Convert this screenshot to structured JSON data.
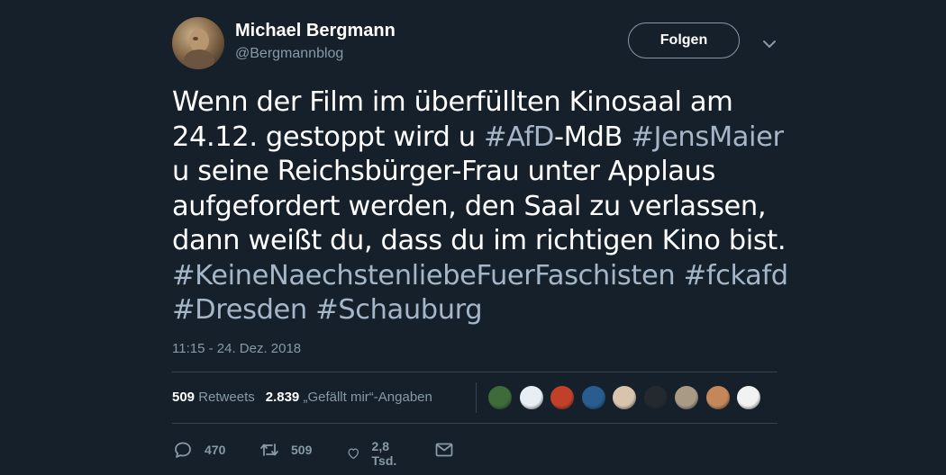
{
  "author": {
    "display_name": "Michael Bergmann",
    "handle": "@Bergmannblog"
  },
  "header": {
    "follow_label": "Folgen"
  },
  "tweet": {
    "lines": [
      [
        {
          "t": "Wenn der Film im überfüllten Kinosaal am",
          "h": false
        }
      ],
      [
        {
          "t": "24.12. gestoppt wird u ",
          "h": false
        },
        {
          "t": "#AfD",
          "h": true
        },
        {
          "t": "-MdB ",
          "h": false
        },
        {
          "t": "#JensMaier",
          "h": true
        }
      ],
      [
        {
          "t": "u seine Reichsbürger-Frau unter Applaus",
          "h": false
        }
      ],
      [
        {
          "t": "aufgefordert werden, den Saal zu verlassen,",
          "h": false
        }
      ],
      [
        {
          "t": "dann weißt du, dass du im richtigen Kino bist.",
          "h": false
        }
      ],
      [
        {
          "t": "#KeineNaechstenliebeFuerFaschisten",
          "h": true
        },
        {
          "t": " ",
          "h": false
        },
        {
          "t": "#fckafd",
          "h": true
        }
      ],
      [
        {
          "t": "#Dresden",
          "h": true
        },
        {
          "t": " ",
          "h": false
        },
        {
          "t": "#Schauburg",
          "h": true
        }
      ]
    ],
    "timestamp": "11:15 - 24. Dez. 2018"
  },
  "stats": {
    "retweets_count": "509",
    "retweets_label": "Retweets",
    "likes_count": "2.839",
    "likes_label": "„Gefällt mir“-Angaben"
  },
  "liked_by_avatars": [
    {
      "name": "liker-avatar-1",
      "color": "#3f6b3a"
    },
    {
      "name": "liker-avatar-2",
      "color": "#e8eef4"
    },
    {
      "name": "liker-avatar-3",
      "color": "#c2402a"
    },
    {
      "name": "liker-avatar-4",
      "color": "#2a5d8f"
    },
    {
      "name": "liker-avatar-5",
      "color": "#d8c3ad"
    },
    {
      "name": "liker-avatar-6",
      "color": "#23292f"
    },
    {
      "name": "liker-avatar-7",
      "color": "#a99a86"
    },
    {
      "name": "liker-avatar-8",
      "color": "#c4875a"
    },
    {
      "name": "liker-avatar-9",
      "color": "#f2f2f2"
    }
  ],
  "actions": {
    "reply_count": "470",
    "retweet_count": "509",
    "like_count": "2,8 Tsd."
  },
  "icons": {
    "reply": "reply-icon",
    "retweet": "retweet-icon",
    "like": "heart-icon",
    "dm": "envelope-icon",
    "more": "chevron-down-icon"
  },
  "colors": {
    "background": "#15202b",
    "hashtag": "#a4b6c7",
    "secondary_text": "#8899a6",
    "divider": "#38444d"
  }
}
